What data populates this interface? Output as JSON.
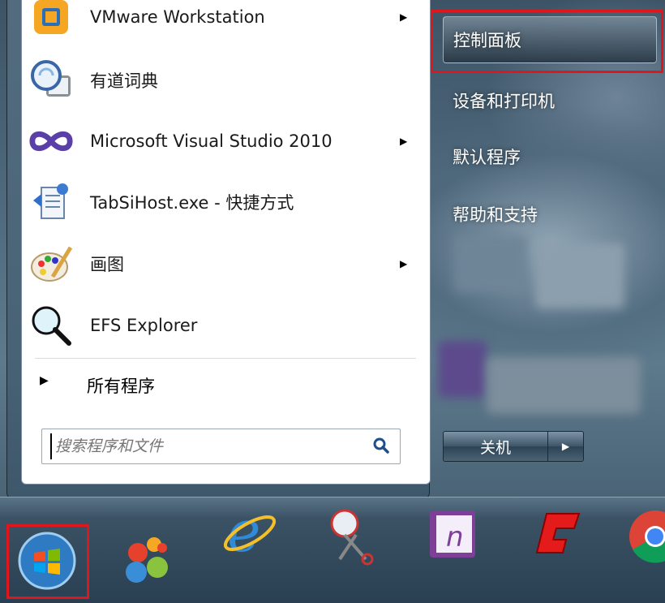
{
  "start_menu": {
    "programs": [
      {
        "label": "VMware Workstation",
        "icon": "vmware-icon",
        "has_submenu": true
      },
      {
        "label": "有道词典",
        "icon": "youdao-dictionary-icon",
        "has_submenu": false
      },
      {
        "label": "Microsoft Visual Studio 2010",
        "icon": "visual-studio-icon",
        "has_submenu": true
      },
      {
        "label": "TabSiHost.exe - 快捷方式",
        "icon": "tabsihost-icon",
        "has_submenu": false
      },
      {
        "label": "画图",
        "icon": "paint-icon",
        "has_submenu": true
      },
      {
        "label": "EFS Explorer",
        "icon": "magnifier-icon",
        "has_submenu": false
      }
    ],
    "all_programs_label": "所有程序",
    "search": {
      "placeholder": "搜索程序和文件"
    },
    "right_items": [
      {
        "label": "控制面板",
        "highlighted": true
      },
      {
        "label": "设备和打印机"
      },
      {
        "label": "默认程序"
      },
      {
        "label": "帮助和支持"
      }
    ],
    "shutdown_label": "关机"
  },
  "taskbar": {
    "items": [
      "start-orb-icon",
      "app-launcher-icon",
      "internet-explorer-icon",
      "snipping-tool-icon",
      "onenote-icon",
      "red-app-icon",
      "chrome-icon"
    ]
  },
  "colors": {
    "highlight_box": "#e0161d"
  }
}
